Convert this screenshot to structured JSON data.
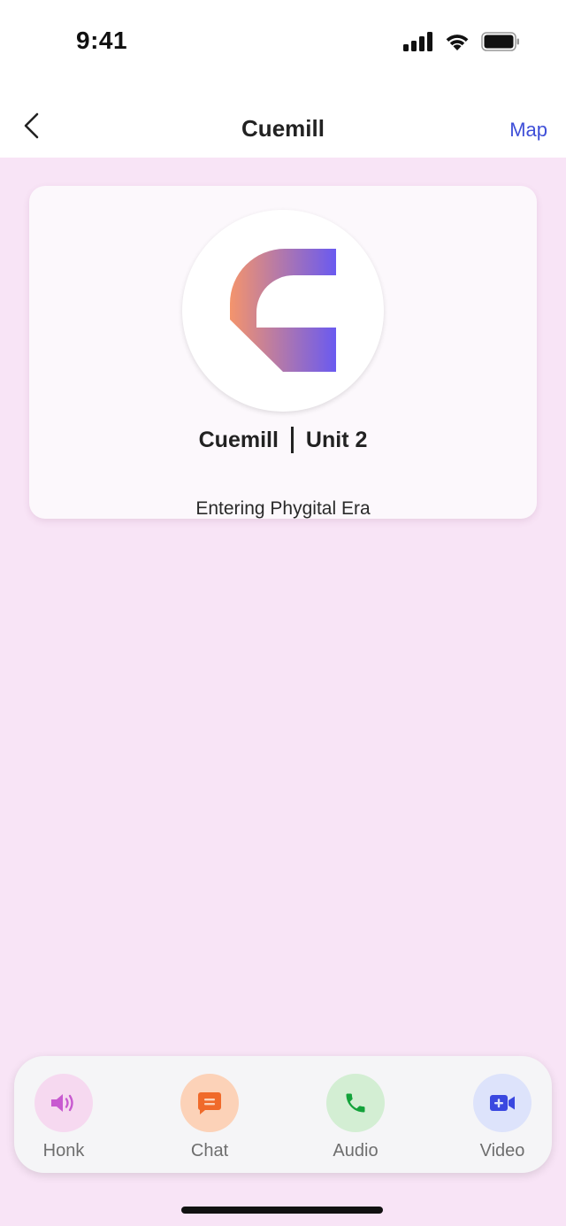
{
  "status_bar": {
    "time": "9:41"
  },
  "nav": {
    "title": "Cuemill",
    "map_label": "Map"
  },
  "card": {
    "name": "Cuemill",
    "unit": "Unit 2",
    "subtitle": "Entering Phygital Era"
  },
  "actions": [
    {
      "label": "Honk",
      "icon": "speaker-icon",
      "bg": "#f6d9f0",
      "color": "#c85ad0"
    },
    {
      "label": "Chat",
      "icon": "chat-bubble-icon",
      "bg": "#fcd2b8",
      "color": "#f06a2a"
    },
    {
      "label": "Audio",
      "icon": "phone-icon",
      "bg": "#d3eed3",
      "color": "#13a23a"
    },
    {
      "label": "Video",
      "icon": "video-camera-icon",
      "bg": "#dde3fb",
      "color": "#3a48e0"
    }
  ],
  "colors": {
    "accent": "#3f4fd8",
    "page_background": "#f8e4f6",
    "logo_gradient_start": "#f4946c",
    "logo_gradient_end": "#6a5af0"
  }
}
